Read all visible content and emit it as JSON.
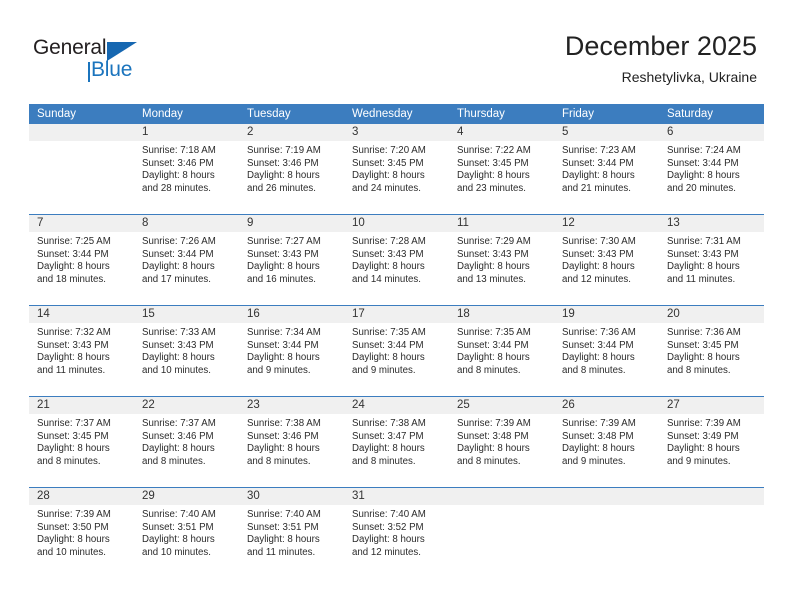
{
  "logo": {
    "word_one": "General",
    "word_two": "Blue",
    "triangle_color": "#1667b1",
    "blue_color": "#1b74bd"
  },
  "header": {
    "title": "December 2025",
    "subtitle": "Reshetylivka, Ukraine",
    "header_bg": "#3c7dbf"
  },
  "weekdays": [
    "Sunday",
    "Monday",
    "Tuesday",
    "Wednesday",
    "Thursday",
    "Friday",
    "Saturday"
  ],
  "labels": {
    "sunrise": "Sunrise:",
    "sunset": "Sunset:",
    "daylight": "Daylight:"
  },
  "weeks": [
    [
      {
        "day": "",
        "empty": true,
        "l1": "",
        "l2": "",
        "l3": "",
        "l4": ""
      },
      {
        "day": "1",
        "l1": "Sunrise: 7:18 AM",
        "l2": "Sunset: 3:46 PM",
        "l3": "Daylight: 8 hours",
        "l4": "and 28 minutes."
      },
      {
        "day": "2",
        "l1": "Sunrise: 7:19 AM",
        "l2": "Sunset: 3:46 PM",
        "l3": "Daylight: 8 hours",
        "l4": "and 26 minutes."
      },
      {
        "day": "3",
        "l1": "Sunrise: 7:20 AM",
        "l2": "Sunset: 3:45 PM",
        "l3": "Daylight: 8 hours",
        "l4": "and 24 minutes."
      },
      {
        "day": "4",
        "l1": "Sunrise: 7:22 AM",
        "l2": "Sunset: 3:45 PM",
        "l3": "Daylight: 8 hours",
        "l4": "and 23 minutes."
      },
      {
        "day": "5",
        "l1": "Sunrise: 7:23 AM",
        "l2": "Sunset: 3:44 PM",
        "l3": "Daylight: 8 hours",
        "l4": "and 21 minutes."
      },
      {
        "day": "6",
        "l1": "Sunrise: 7:24 AM",
        "l2": "Sunset: 3:44 PM",
        "l3": "Daylight: 8 hours",
        "l4": "and 20 minutes."
      }
    ],
    [
      {
        "day": "7",
        "l1": "Sunrise: 7:25 AM",
        "l2": "Sunset: 3:44 PM",
        "l3": "Daylight: 8 hours",
        "l4": "and 18 minutes."
      },
      {
        "day": "8",
        "l1": "Sunrise: 7:26 AM",
        "l2": "Sunset: 3:44 PM",
        "l3": "Daylight: 8 hours",
        "l4": "and 17 minutes."
      },
      {
        "day": "9",
        "l1": "Sunrise: 7:27 AM",
        "l2": "Sunset: 3:43 PM",
        "l3": "Daylight: 8 hours",
        "l4": "and 16 minutes."
      },
      {
        "day": "10",
        "l1": "Sunrise: 7:28 AM",
        "l2": "Sunset: 3:43 PM",
        "l3": "Daylight: 8 hours",
        "l4": "and 14 minutes."
      },
      {
        "day": "11",
        "l1": "Sunrise: 7:29 AM",
        "l2": "Sunset: 3:43 PM",
        "l3": "Daylight: 8 hours",
        "l4": "and 13 minutes."
      },
      {
        "day": "12",
        "l1": "Sunrise: 7:30 AM",
        "l2": "Sunset: 3:43 PM",
        "l3": "Daylight: 8 hours",
        "l4": "and 12 minutes."
      },
      {
        "day": "13",
        "l1": "Sunrise: 7:31 AM",
        "l2": "Sunset: 3:43 PM",
        "l3": "Daylight: 8 hours",
        "l4": "and 11 minutes."
      }
    ],
    [
      {
        "day": "14",
        "l1": "Sunrise: 7:32 AM",
        "l2": "Sunset: 3:43 PM",
        "l3": "Daylight: 8 hours",
        "l4": "and 11 minutes."
      },
      {
        "day": "15",
        "l1": "Sunrise: 7:33 AM",
        "l2": "Sunset: 3:43 PM",
        "l3": "Daylight: 8 hours",
        "l4": "and 10 minutes."
      },
      {
        "day": "16",
        "l1": "Sunrise: 7:34 AM",
        "l2": "Sunset: 3:44 PM",
        "l3": "Daylight: 8 hours",
        "l4": "and 9 minutes."
      },
      {
        "day": "17",
        "l1": "Sunrise: 7:35 AM",
        "l2": "Sunset: 3:44 PM",
        "l3": "Daylight: 8 hours",
        "l4": "and 9 minutes."
      },
      {
        "day": "18",
        "l1": "Sunrise: 7:35 AM",
        "l2": "Sunset: 3:44 PM",
        "l3": "Daylight: 8 hours",
        "l4": "and 8 minutes."
      },
      {
        "day": "19",
        "l1": "Sunrise: 7:36 AM",
        "l2": "Sunset: 3:44 PM",
        "l3": "Daylight: 8 hours",
        "l4": "and 8 minutes."
      },
      {
        "day": "20",
        "l1": "Sunrise: 7:36 AM",
        "l2": "Sunset: 3:45 PM",
        "l3": "Daylight: 8 hours",
        "l4": "and 8 minutes."
      }
    ],
    [
      {
        "day": "21",
        "l1": "Sunrise: 7:37 AM",
        "l2": "Sunset: 3:45 PM",
        "l3": "Daylight: 8 hours",
        "l4": "and 8 minutes."
      },
      {
        "day": "22",
        "l1": "Sunrise: 7:37 AM",
        "l2": "Sunset: 3:46 PM",
        "l3": "Daylight: 8 hours",
        "l4": "and 8 minutes."
      },
      {
        "day": "23",
        "l1": "Sunrise: 7:38 AM",
        "l2": "Sunset: 3:46 PM",
        "l3": "Daylight: 8 hours",
        "l4": "and 8 minutes."
      },
      {
        "day": "24",
        "l1": "Sunrise: 7:38 AM",
        "l2": "Sunset: 3:47 PM",
        "l3": "Daylight: 8 hours",
        "l4": "and 8 minutes."
      },
      {
        "day": "25",
        "l1": "Sunrise: 7:39 AM",
        "l2": "Sunset: 3:48 PM",
        "l3": "Daylight: 8 hours",
        "l4": "and 8 minutes."
      },
      {
        "day": "26",
        "l1": "Sunrise: 7:39 AM",
        "l2": "Sunset: 3:48 PM",
        "l3": "Daylight: 8 hours",
        "l4": "and 9 minutes."
      },
      {
        "day": "27",
        "l1": "Sunrise: 7:39 AM",
        "l2": "Sunset: 3:49 PM",
        "l3": "Daylight: 8 hours",
        "l4": "and 9 minutes."
      }
    ],
    [
      {
        "day": "28",
        "l1": "Sunrise: 7:39 AM",
        "l2": "Sunset: 3:50 PM",
        "l3": "Daylight: 8 hours",
        "l4": "and 10 minutes."
      },
      {
        "day": "29",
        "l1": "Sunrise: 7:40 AM",
        "l2": "Sunset: 3:51 PM",
        "l3": "Daylight: 8 hours",
        "l4": "and 10 minutes."
      },
      {
        "day": "30",
        "l1": "Sunrise: 7:40 AM",
        "l2": "Sunset: 3:51 PM",
        "l3": "Daylight: 8 hours",
        "l4": "and 11 minutes."
      },
      {
        "day": "31",
        "l1": "Sunrise: 7:40 AM",
        "l2": "Sunset: 3:52 PM",
        "l3": "Daylight: 8 hours",
        "l4": "and 12 minutes."
      },
      {
        "day": "",
        "empty": true,
        "l1": "",
        "l2": "",
        "l3": "",
        "l4": ""
      },
      {
        "day": "",
        "empty": true,
        "l1": "",
        "l2": "",
        "l3": "",
        "l4": ""
      },
      {
        "day": "",
        "empty": true,
        "l1": "",
        "l2": "",
        "l3": "",
        "l4": ""
      }
    ]
  ]
}
